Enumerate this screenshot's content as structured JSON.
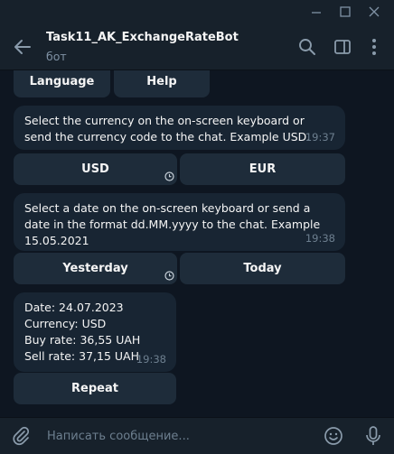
{
  "app": {
    "window_controls": [
      "minimize",
      "maximize",
      "close"
    ]
  },
  "header": {
    "title": "Task11_AK_ExchangeRateBot",
    "status": "бот",
    "icons": [
      "back-arrow-icon",
      "search-icon",
      "sidebar-toggle-icon",
      "more-vert-icon"
    ]
  },
  "top_keyboard": {
    "buttons": [
      "Language",
      "Help"
    ]
  },
  "messages": [
    {
      "text": "Select the currency on the on-screen keyboard or send the currency code to the chat. Example USD.",
      "time": "19:37",
      "keyboard": [
        "USD",
        "EUR"
      ]
    },
    {
      "text": "Select a date on the on-screen keyboard or send a date in the format dd.MM.yyyy to the chat. Example 15.05.2021",
      "time": "19:38",
      "keyboard": [
        "Yesterday",
        "Today"
      ]
    },
    {
      "lines": [
        "Date: 24.07.2023",
        "Currency: USD",
        "Buy rate: 36,55 UAH",
        "Sell rate: 37,15 UAH"
      ],
      "time": "19:38",
      "keyboard": [
        "Repeat"
      ]
    }
  ],
  "composer": {
    "placeholder": "Написать сообщение...",
    "icons": [
      "attach-icon",
      "emoji-icon",
      "microphone-icon"
    ]
  },
  "colors": {
    "background": "#0e1621",
    "panel": "#17212b",
    "bubble": "#182533",
    "keyboard_button": "#1e2c3a",
    "secondary_text": "#7f91a4"
  }
}
